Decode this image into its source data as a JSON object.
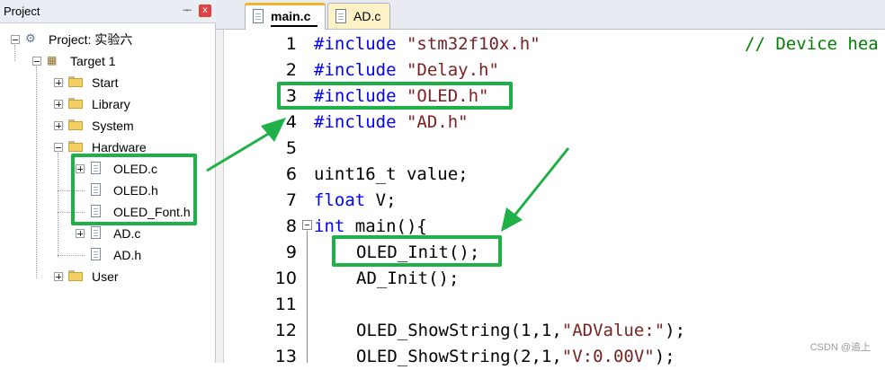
{
  "panel": {
    "title": "Project",
    "pin_glyph": "ᅮ",
    "close_glyph": "x"
  },
  "tree": {
    "project": "Project: 实验六",
    "target": "Target 1",
    "groups": [
      "Start",
      "Library",
      "System",
      "Hardware"
    ],
    "hardware_files": [
      "OLED.c",
      "OLED.h",
      "OLED_Font.h",
      "AD.c",
      "AD.h"
    ],
    "user": "User"
  },
  "tabs": [
    {
      "label": "main.c",
      "active": true
    },
    {
      "label": "AD.c",
      "active": false
    }
  ],
  "editor": {
    "line_numbers": [
      "1",
      "2",
      "3",
      "4",
      "5",
      "6",
      "7",
      "8",
      "9",
      "10",
      "11",
      "12",
      "13"
    ],
    "lines": {
      "l1_kw": "#include",
      "l1_str": "\"stm32f10x.h\"",
      "l1_cm": "// Device hea",
      "l2_kw": "#include",
      "l2_str": "\"Delay.h\"",
      "l3_kw": "#include",
      "l3_str": "\"OLED.h\"",
      "l4_kw": "#include",
      "l4_str": "\"AD.h\"",
      "l6": "uint16_t value;",
      "l7_kw": "float",
      "l7_rest": " V;",
      "l8_kw": "int",
      "l8_rest": " main(){",
      "l9": "OLED_Init();",
      "l10": "AD_Init();",
      "l12_a": "OLED_ShowString(1,1,",
      "l12_str": "\"ADValue:\"",
      "l12_b": ");",
      "l13_a": "OLED_ShowString(2,1,",
      "l13_str": "\"V:0.00V\"",
      "l13_b": ");"
    }
  },
  "colors": {
    "highlight": "#20b048",
    "keyword": "#0000ff",
    "string": "#7b2222",
    "comment": "#008000"
  },
  "watermark": "CSDN @追上"
}
